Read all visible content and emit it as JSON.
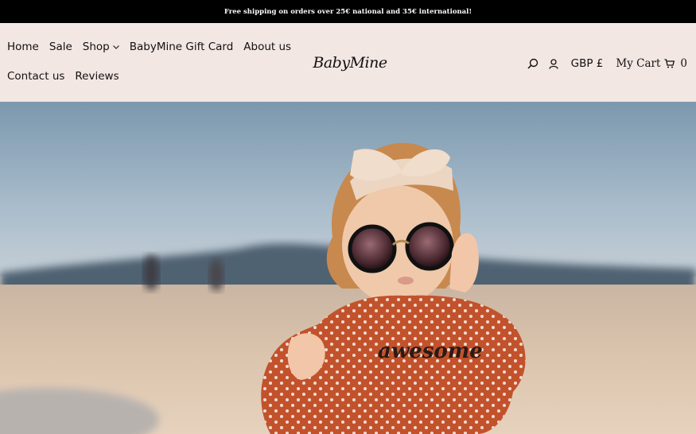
{
  "announcement": {
    "text": "Free shipping on orders over 25€ national and 35€ international!"
  },
  "nav": {
    "items": [
      {
        "label": "Home"
      },
      {
        "label": "Sale"
      },
      {
        "label": "Shop"
      },
      {
        "label": "BabyMine Gift Card"
      },
      {
        "label": "About us"
      },
      {
        "label": "Contact us"
      },
      {
        "label": "Reviews"
      }
    ]
  },
  "logo": {
    "text": "BabyMine"
  },
  "utility": {
    "currency": "GBP £",
    "cart_label": "My Cart",
    "cart_count": "0",
    "icons": [
      "search-icon",
      "account-icon",
      "cart-icon",
      "chevron-down-icon"
    ]
  },
  "hero": {
    "shirt_text": "awesome"
  },
  "colors": {
    "announcement_bg": "#000000",
    "header_bg": "#f3e7e4",
    "sweater": "#c2522c"
  }
}
